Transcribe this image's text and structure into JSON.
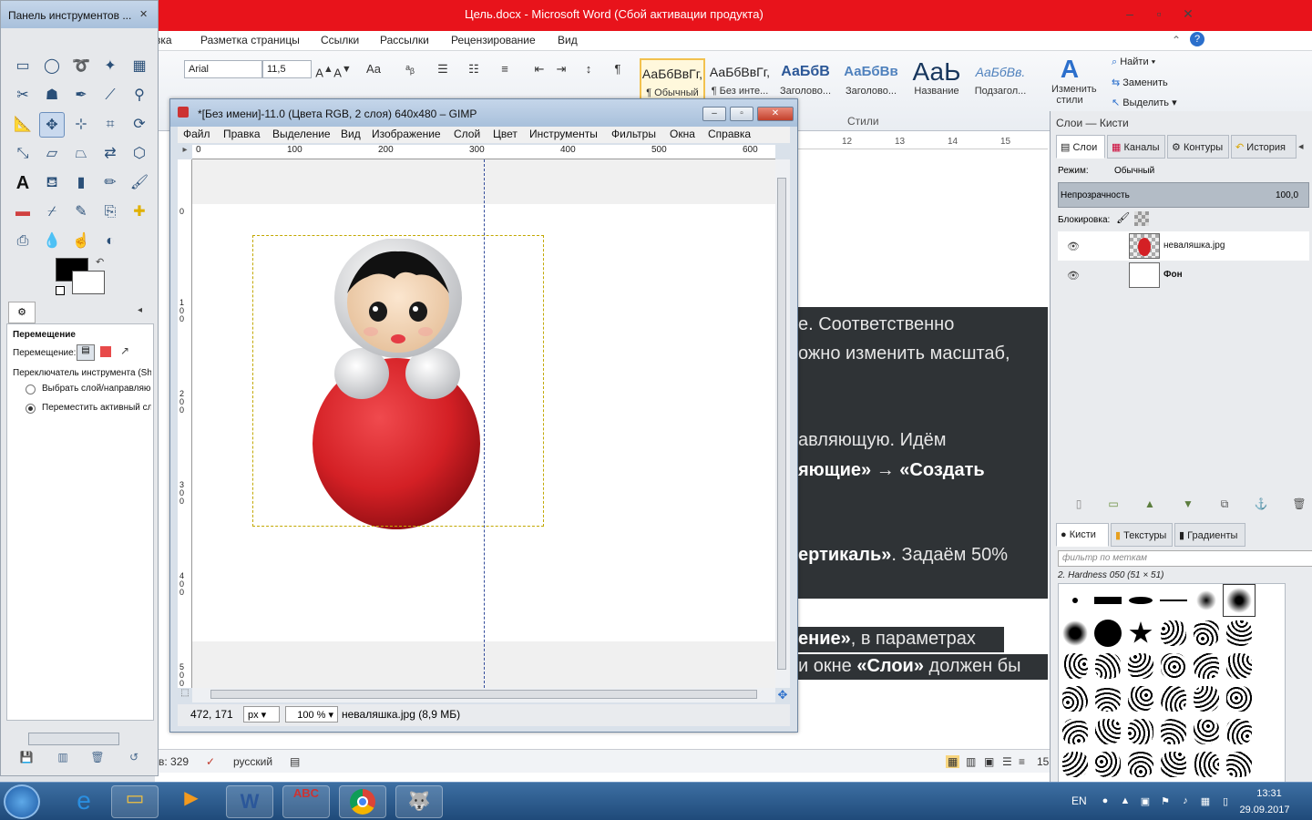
{
  "word": {
    "title": "Цель.docx - Microsoft Word (Сбой активации продукта)",
    "menu": [
      "вка",
      "Разметка страницы",
      "Ссылки",
      "Рассылки",
      "Рецензирование",
      "Вид"
    ],
    "font_name": "Arial",
    "font_size": "11,5",
    "styles": [
      {
        "sample": "АаБбВвГг,",
        "name": "¶ Обычный"
      },
      {
        "sample": "АаБбВвГг,",
        "name": "¶ Без инте..."
      },
      {
        "sample": "АаБбВ",
        "name": "Заголово..."
      },
      {
        "sample": "АаБбВв",
        "name": "Заголово..."
      },
      {
        "sample": "АаЬ",
        "name": "Название"
      },
      {
        "sample": "АаБбВв.",
        "name": "Подзагол..."
      }
    ],
    "change_styles": "Изменить стили",
    "find": "Найти",
    "replace": "Заменить",
    "select": "Выделить",
    "styles_group_label": "Стили",
    "ruler_numbers": [
      "12",
      "13",
      "14",
      "15"
    ],
    "doc_lines": {
      "l1": "е. Соответственно",
      "l2": "ожно изменить масштаб,",
      "l3": "авляющую.  Идём",
      "l4a": "яющие»",
      "l4b": " → ",
      "l4c": "«Создать",
      "l5a": "ертикаль»",
      "l5b": ". Задаём 50%",
      "l6a": "ение»",
      "l6b": ", в параметрах",
      "l7a": "и окне ",
      "l7b": "«Слои»",
      "l7c": " должен бы"
    },
    "status_words": "в: 329",
    "status_lang": "русский",
    "status_zoom": "15"
  },
  "toolbox": {
    "title": "Панель инструментов ...",
    "options_title": "Перемещение",
    "move_label": "Перемещение:",
    "switch_label": "Переключатель инструмента  (Sh",
    "radio1": "Выбрать слой/направляю",
    "radio2": "Переместить активный сл"
  },
  "gimp": {
    "title": "*[Без имени]-11.0 (Цвета RGB, 2 слоя) 640x480 – GIMP",
    "menu": [
      "Файл",
      "Правка",
      "Выделение",
      "Вид",
      "Изображение",
      "Слой",
      "Цвет",
      "Инструменты",
      "Фильтры",
      "Окна",
      "Справка"
    ],
    "hruler": [
      "0",
      "100",
      "200",
      "300",
      "400",
      "500",
      "600"
    ],
    "vruler": [
      "0",
      "100",
      "200",
      "300",
      "400",
      "500"
    ],
    "coords": "472, 171",
    "unit": "px",
    "zoom": "100 %",
    "image_info": "неваляшка.jpg (8,9 МБ)"
  },
  "dock": {
    "title": "Слои — Кисти",
    "tabs": [
      "Слои",
      "Каналы",
      "Контуры",
      "История"
    ],
    "mode_label": "Режим:",
    "mode_value": "Обычный",
    "opacity_label": "Непрозрачность",
    "opacity_value": "100,0",
    "lock_label": "Блокировка:",
    "layers": [
      {
        "name": "неваляшка.jpg"
      },
      {
        "name": "Фон"
      }
    ],
    "brush_tabs": [
      "Кисти",
      "Текстуры",
      "Градиенты"
    ],
    "brush_filter": "фильтр по меткам",
    "brush_name": "2. Hardness 050 (51 × 51)"
  },
  "taskbar": {
    "lang": "EN",
    "time": "13:31",
    "date": "29.09.2017"
  },
  "colors": {
    "word_titlebar": "#e8131b",
    "doc_dark": "#2f3336",
    "doll_red": "#d42025",
    "guide": "#334c9b",
    "selection": "#c2a800"
  }
}
